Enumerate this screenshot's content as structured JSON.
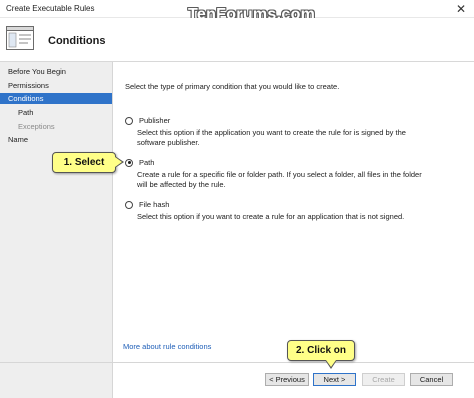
{
  "window": {
    "title": "Create Executable Rules",
    "close_glyph": "✕"
  },
  "watermark": "TenForums.com",
  "header": {
    "title": "Conditions",
    "icon": "wizard-page-icon"
  },
  "sidebar": {
    "items": [
      {
        "label": "Before You Begin"
      },
      {
        "label": "Permissions"
      },
      {
        "label": "Conditions"
      },
      {
        "label": "Path"
      },
      {
        "label": "Exceptions"
      },
      {
        "label": "Name"
      }
    ]
  },
  "main": {
    "intro": "Select the type of primary condition that you would like to create.",
    "options": [
      {
        "label": "Publisher",
        "description": "Select this option if the application you want to create the rule for is signed by the software publisher.",
        "checked": false
      },
      {
        "label": "Path",
        "description": "Create a rule for a specific file or folder path. If you select a folder, all files in the folder will be affected by the rule.",
        "checked": true
      },
      {
        "label": "File hash",
        "description": "Select this option if you want to create a rule for an application that is not signed.",
        "checked": false
      }
    ],
    "more_link": "More about rule conditions"
  },
  "buttons": {
    "previous": "< Previous",
    "next": "Next >",
    "create": "Create",
    "cancel": "Cancel"
  },
  "callouts": {
    "select": "1. Select",
    "click": "2. Click on"
  },
  "colors": {
    "selection": "#2f73c9",
    "callout_fill": "#ffff88",
    "link": "#1f5fb8"
  }
}
